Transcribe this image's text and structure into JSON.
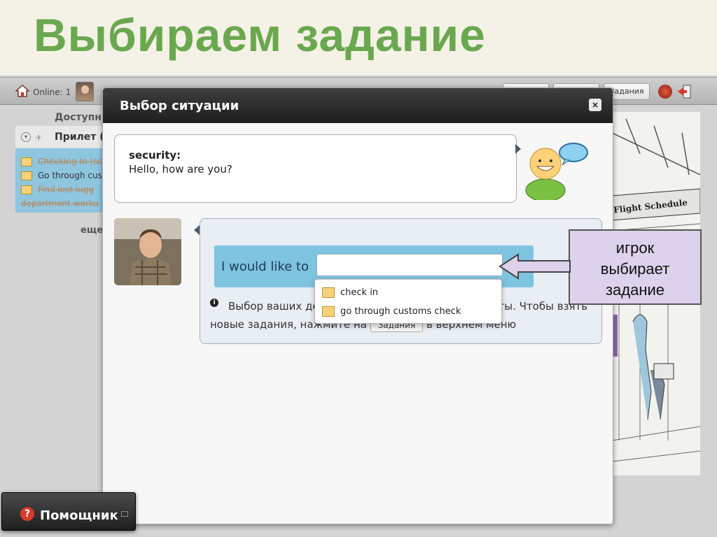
{
  "slide": {
    "title": "Выбираем задание"
  },
  "topbar": {
    "online_label": "Online: 1",
    "tasks_button": "Задания"
  },
  "left_panel": {
    "heading": "Доступн",
    "group_label": "Прилет (",
    "tasks": [
      {
        "label": "Checking In (sc",
        "done": true
      },
      {
        "label": "Go through cus",
        "done": false
      },
      {
        "label": "Find lost lugg",
        "done": true
      },
      {
        "label": "department worko",
        "done": true
      }
    ],
    "more_label": "еще"
  },
  "modal": {
    "title": "Выбор ситуации",
    "close_glyph": "×",
    "npc_line": {
      "speaker": "security:",
      "text": "Hello, how are you?"
    },
    "prompt_lead": "I would like to",
    "input_value": "",
    "info_text_1": "Выбор ваших де",
    "info_text_2": "ые у вас взяты. Чтобы взять новые задания, нажмите на",
    "info_button": "Задания",
    "info_text_3": "в верхнем меню",
    "dropdown_options": [
      "check in",
      "go through customs check"
    ]
  },
  "illustration": {
    "sign_text": "Flight Schedule"
  },
  "callout": {
    "text_lines": [
      "игрок",
      "выбирает",
      "задание"
    ]
  },
  "helper": {
    "label": "Помощник"
  },
  "colors": {
    "title_green": "#6aa84f",
    "choice_blue": "#7ec3e0",
    "callout_lilac": "#dcd2ec",
    "header_dark": "#2a2a2a"
  }
}
